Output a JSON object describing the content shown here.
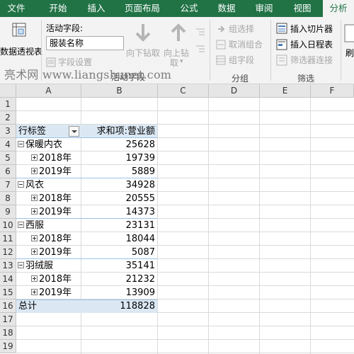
{
  "tabs": [
    "文件",
    "开始",
    "插入",
    "页面布局",
    "公式",
    "数据",
    "审阅",
    "视图",
    "分析"
  ],
  "ribbon": {
    "pivot_label": "数据透视表",
    "active_field_label": "活动字段:",
    "active_field_value": "服装名称",
    "field_settings": "字段设置",
    "drill_down": "向下钻取",
    "drill_up_1": "向上钻",
    "drill_up_2": "取",
    "drill_up_arrow": "▾",
    "active_field_group": "活动字段",
    "group_selection": "组选择",
    "ungroup": "取消组合",
    "group_field": "组字段",
    "group_label": "分组",
    "insert_slicer": "插入切片器",
    "insert_timeline": "插入日程表",
    "filter_connections": "筛选器连接",
    "filter_label": "筛选",
    "cut_off": "刷"
  },
  "watermark": "亮术网 www.liangshunet.com",
  "columns": [
    "A",
    "B",
    "C",
    "D",
    "E",
    "F"
  ],
  "rows": [
    "1",
    "2",
    "3",
    "4",
    "5",
    "6",
    "7",
    "8",
    "9",
    "10",
    "11",
    "12",
    "13",
    "14",
    "15",
    "16",
    "17",
    "18",
    "19"
  ],
  "pivot": {
    "row_label": "行标签",
    "value_label": "求和项:营业额",
    "items": [
      {
        "label": "保暖内衣",
        "value": "25628",
        "level": 0
      },
      {
        "label": "2018年",
        "value": "19739",
        "level": 1
      },
      {
        "label": "2019年",
        "value": "5889",
        "level": 1
      },
      {
        "label": "风衣",
        "value": "34928",
        "level": 0
      },
      {
        "label": "2018年",
        "value": "20555",
        "level": 1
      },
      {
        "label": "2019年",
        "value": "14373",
        "level": 1
      },
      {
        "label": "西服",
        "value": "23131",
        "level": 0
      },
      {
        "label": "2018年",
        "value": "18044",
        "level": 1
      },
      {
        "label": "2019年",
        "value": "5087",
        "level": 1
      },
      {
        "label": "羽绒服",
        "value": "35141",
        "level": 0
      },
      {
        "label": "2018年",
        "value": "21232",
        "level": 1
      },
      {
        "label": "2019年",
        "value": "13909",
        "level": 1
      }
    ],
    "total_label": "总计",
    "total_value": "118828"
  },
  "colors": {
    "tab_bar": "#217346",
    "pivot_header": "#dbe8f4",
    "pivot_rule": "#9bc2e6"
  }
}
